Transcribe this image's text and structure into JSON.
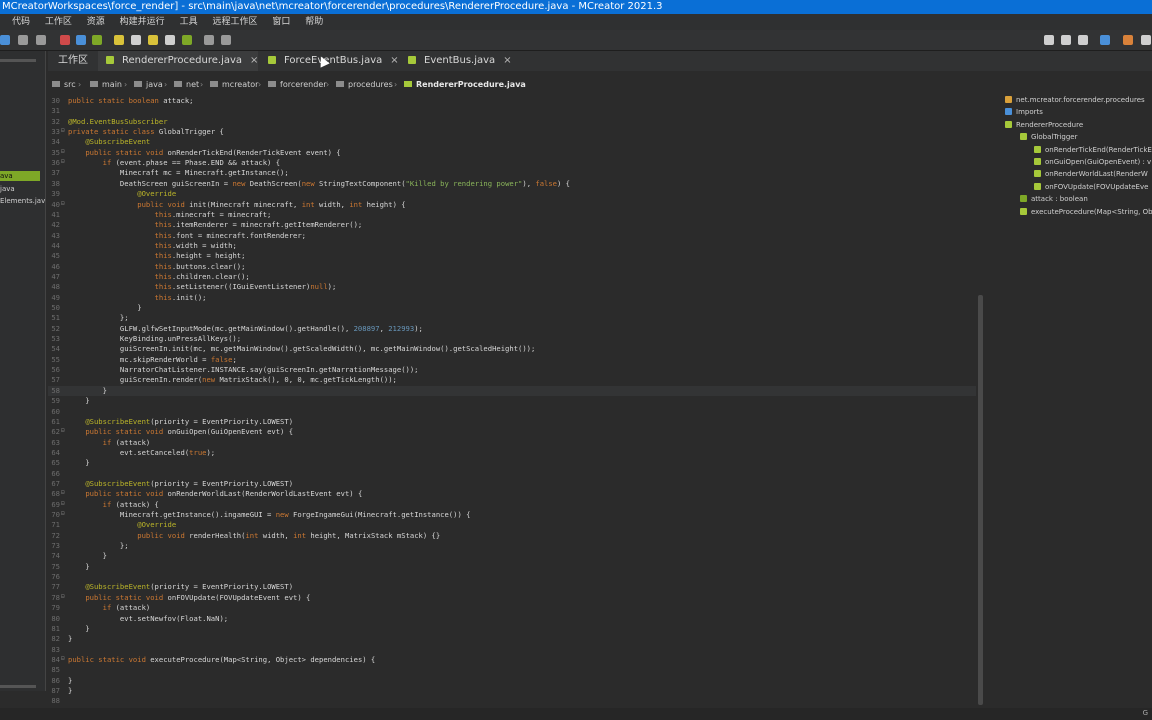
{
  "window": {
    "title": "MCreatorWorkspaces\\force_render] - src\\main\\java\\net\\mcreator\\forcerender\\procedures\\RendererProcedure.java - MCreator 2021.3"
  },
  "menu": [
    "代码",
    "工作区",
    "资源",
    "构建并运行",
    "工具",
    "远程工作区",
    "窗口",
    "帮助"
  ],
  "left_panel": {
    "items": [
      "ava",
      "java",
      "Elements.jav"
    ]
  },
  "tabs": [
    {
      "label": "工作区",
      "active": false
    },
    {
      "label": "RendererProcedure.java",
      "active": true,
      "close": "×"
    },
    {
      "label": "ForceEventBus.java",
      "active": false,
      "close": "×"
    },
    {
      "label": "EventBus.java",
      "active": false,
      "close": "×"
    }
  ],
  "breadcrumb": [
    "src",
    "main",
    "java",
    "net",
    "mcreator",
    "forcerender",
    "procedures",
    "RendererProcedure.java"
  ],
  "breadcrumb_sep": "›",
  "code_lines": [
    {
      "n": "30",
      "t": "public static boolean attack;"
    },
    {
      "n": "31",
      "t": ""
    },
    {
      "n": "32",
      "t": "@Mod.EventBusSubscriber"
    },
    {
      "n": "33",
      "t": "private static class GlobalTrigger {"
    },
    {
      "n": "34",
      "t": "    @SubscribeEvent"
    },
    {
      "n": "35",
      "t": "    public static void onRenderTickEnd(RenderTickEvent event) {"
    },
    {
      "n": "36",
      "t": "        if (event.phase == Phase.END && attack) {"
    },
    {
      "n": "37",
      "t": "            Minecraft mc = Minecraft.getInstance();"
    },
    {
      "n": "38",
      "t": "            DeathScreen guiScreenIn = new DeathScreen(new StringTextComponent(\"Killed by rendering power\"), false) {"
    },
    {
      "n": "39",
      "t": "                @Override"
    },
    {
      "n": "40",
      "t": "                public void init(Minecraft minecraft, int width, int height) {"
    },
    {
      "n": "41",
      "t": "                    this.minecraft = minecraft;"
    },
    {
      "n": "42",
      "t": "                    this.itemRenderer = minecraft.getItemRenderer();"
    },
    {
      "n": "43",
      "t": "                    this.font = minecraft.fontRenderer;"
    },
    {
      "n": "44",
      "t": "                    this.width = width;"
    },
    {
      "n": "45",
      "t": "                    this.height = height;"
    },
    {
      "n": "46",
      "t": "                    this.buttons.clear();"
    },
    {
      "n": "47",
      "t": "                    this.children.clear();"
    },
    {
      "n": "48",
      "t": "                    this.setListener((IGuiEventListener)null);"
    },
    {
      "n": "49",
      "t": "                    this.init();"
    },
    {
      "n": "50",
      "t": "                }"
    },
    {
      "n": "51",
      "t": "            };"
    },
    {
      "n": "52",
      "t": "            GLFW.glfwSetInputMode(mc.getMainWindow().getHandle(), 208897, 212993);"
    },
    {
      "n": "53",
      "t": "            KeyBinding.unPressAllKeys();"
    },
    {
      "n": "54",
      "t": "            guiScreenIn.init(mc, mc.getMainWindow().getScaledWidth(), mc.getMainWindow().getScaledHeight());"
    },
    {
      "n": "55",
      "t": "            mc.skipRenderWorld = false;"
    },
    {
      "n": "56",
      "t": "            NarratorChatListener.INSTANCE.say(guiScreenIn.getNarrationMessage());"
    },
    {
      "n": "57",
      "t": "            guiScreenIn.render(new MatrixStack(), 0, 0, mc.getTickLength());"
    },
    {
      "n": "58",
      "t": "        }"
    },
    {
      "n": "59",
      "t": "    }"
    },
    {
      "n": "60",
      "t": ""
    },
    {
      "n": "61",
      "t": "    @SubscribeEvent(priority = EventPriority.LOWEST)"
    },
    {
      "n": "62",
      "t": "    public static void onGuiOpen(GuiOpenEvent evt) {"
    },
    {
      "n": "63",
      "t": "        if (attack)"
    },
    {
      "n": "64",
      "t": "            evt.setCanceled(true);"
    },
    {
      "n": "65",
      "t": "    }"
    },
    {
      "n": "66",
      "t": ""
    },
    {
      "n": "67",
      "t": "    @SubscribeEvent(priority = EventPriority.LOWEST)"
    },
    {
      "n": "68",
      "t": "    public static void onRenderWorldLast(RenderWorldLastEvent evt) {"
    },
    {
      "n": "69",
      "t": "        if (attack) {"
    },
    {
      "n": "70",
      "t": "            Minecraft.getInstance().ingameGUI = new ForgeIngameGui(Minecraft.getInstance()) {"
    },
    {
      "n": "71",
      "t": "                @Override"
    },
    {
      "n": "72",
      "t": "                public void renderHealth(int width, int height, MatrixStack mStack) {}"
    },
    {
      "n": "73",
      "t": "            };"
    },
    {
      "n": "74",
      "t": "        }"
    },
    {
      "n": "75",
      "t": "    }"
    },
    {
      "n": "76",
      "t": ""
    },
    {
      "n": "77",
      "t": "    @SubscribeEvent(priority = EventPriority.LOWEST)"
    },
    {
      "n": "78",
      "t": "    public static void onFOVUpdate(FOVUpdateEvent evt) {"
    },
    {
      "n": "79",
      "t": "        if (attack)"
    },
    {
      "n": "80",
      "t": "            evt.setNewfov(Float.NaN);"
    },
    {
      "n": "81",
      "t": "    }"
    },
    {
      "n": "82",
      "t": "}"
    },
    {
      "n": "83",
      "t": ""
    },
    {
      "n": "84",
      "t": "public static void executeProcedure(Map<String, Object> dependencies) {"
    },
    {
      "n": "85",
      "t": ""
    },
    {
      "n": "86",
      "t": "}"
    },
    {
      "n": "87",
      "t": "}"
    },
    {
      "n": "88",
      "t": ""
    }
  ],
  "outline": [
    {
      "label": "net.mcreator.forcerender.procedures",
      "color": "#d9a03a"
    },
    {
      "label": "Imports",
      "color": "#4a90d9"
    },
    {
      "label": "RendererProcedure",
      "color": "#a6c93a"
    },
    {
      "label": "GlobalTrigger",
      "color": "#a6c93a"
    },
    {
      "label": "onRenderTickEnd(RenderTickE",
      "color": "#a6c93a"
    },
    {
      "label": "onGuiOpen(GuiOpenEvent) : v",
      "color": "#a6c93a"
    },
    {
      "label": "onRenderWorldLast(RenderW",
      "color": "#a6c93a"
    },
    {
      "label": "onFOVUpdate(FOVUpdateEve",
      "color": "#a6c93a"
    },
    {
      "label": "attack : boolean",
      "color": "#7ea827"
    },
    {
      "label": "executeProcedure(Map<String, Ob",
      "color": "#a6c93a"
    }
  ],
  "status": {
    "right": "G"
  }
}
